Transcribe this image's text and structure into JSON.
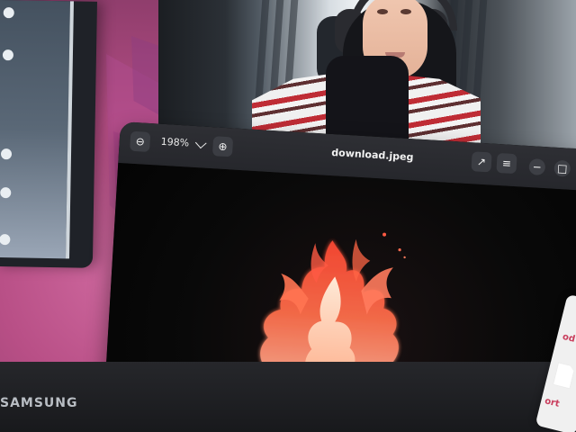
{
  "monitor": {
    "brand": "SAMSUNG"
  },
  "viewer": {
    "title": "download.jpeg",
    "zoom_level": "198%",
    "controls": {
      "zoom_out": "zoom-out-icon",
      "zoom_menu": "chevron-down-icon",
      "zoom_in": "zoom-in-icon",
      "fullscreen": "fullscreen-icon",
      "menu": "menu-icon",
      "minimize": "minimize-icon",
      "maximize": "maximize-icon"
    }
  },
  "right_peek": {
    "top_text": "od",
    "bottom_text": "ort"
  },
  "colors": {
    "wallpaper": "#b84f86",
    "viewer_bg": "#0b0b0d",
    "viewer_header": "#2e2f34",
    "flame_primary": "#ff5a2f",
    "flame_highlight": "#ffe1c8"
  }
}
